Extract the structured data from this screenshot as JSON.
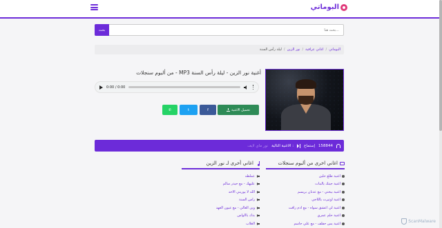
{
  "header": {
    "logo_text": "البوماتي",
    "search": {
      "placeholder": "بحث هنا...",
      "button": "بحث"
    }
  },
  "breadcrumb": [
    "البوماتي",
    "اغاني عراقية",
    "نور الزين",
    "ليلة رأس السنة"
  ],
  "song": {
    "title": "أغنية نور الزين - ليلة رأس السنة MP3 - من ألبوم سنجلات",
    "audio_time": "0:00 / 0:00"
  },
  "actions": {
    "download": "تحميل الاغنية",
    "facebook": "f",
    "twitter": "t"
  },
  "stats": {
    "listens_count": "158844",
    "listens_label": "إستماع",
    "next_label": "الاغنية التالية :",
    "next_song": "نور ماي لايف"
  },
  "album_section": {
    "title": "اغاني اخرى من ألبوم سنجلات",
    "items": [
      "اغنية طلع حلين",
      "اغنية جيتك يالبنات",
      "اغنية بيختي - مع عدنان بريسم",
      "اغنية اوتيرت ياللاجي",
      "اغنية لي اعشق سواه - مع ادم رافت",
      "اغنية حلم عمري",
      "اغنية يس حفلف - مع علي حاسم"
    ]
  },
  "artist_section": {
    "title": "اغاني أخرى لـ نور الزين",
    "items": [
      "عملطه",
      "عليهك - مع حيدر سالم",
      "الله لا يوريني الاحد",
      "راس السنة",
      "وين الغالي - مع عيون العهد",
      "بدك ياالواس",
      "الغلاب"
    ]
  },
  "watermark": "ScanMalware",
  "colors": {
    "accent": "#6c2bd9",
    "download": "#2e8b57",
    "facebook": "#3b5998",
    "twitter": "#1da1f2",
    "whatsapp": "#25d366"
  }
}
